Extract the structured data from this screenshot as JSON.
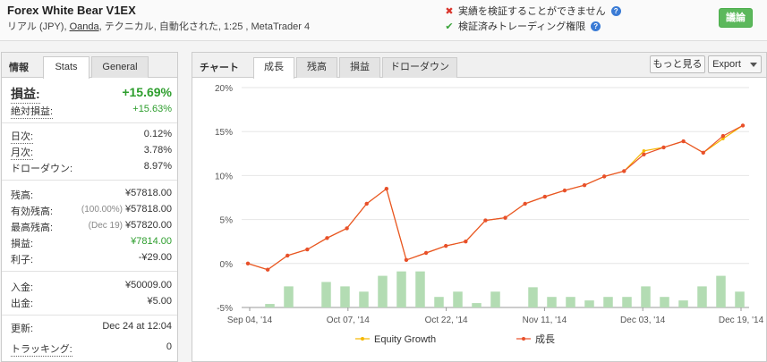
{
  "header": {
    "title": "Forex White Bear V1EX",
    "subtitle_pre": "リアル (JPY), ",
    "subtitle_link": "Oanda",
    "subtitle_post": ", テクニカル, 自動化された, 1:25 , MetaTrader 4",
    "verify_1": "実績を検証することができません",
    "verify_2": "検証済みトレーディング権限",
    "discuss_label": "議論"
  },
  "left": {
    "heading": "情報",
    "tabs": [
      "Stats",
      "General"
    ],
    "gain_label": "損益:",
    "gain_value": "+15.69%",
    "abs_gain_label": "絶対損益:",
    "abs_gain_value": "+15.63%",
    "daily_label": "日次:",
    "daily_value": "0.12%",
    "monthly_label": "月次:",
    "monthly_value": "3.78%",
    "drawdown_label": "ドローダウン:",
    "drawdown_value": "8.97%",
    "balance_label": "残高:",
    "balance_value": "¥57818.00",
    "equity_label": "有効残高:",
    "equity_note": "(100.00%)",
    "equity_value": "¥57818.00",
    "highest_label": "最高残高:",
    "highest_note": "(Dec 19)",
    "highest_value": "¥57820.00",
    "profit_label": "損益:",
    "profit_value": "¥7814.00",
    "interest_label": "利子:",
    "interest_value": "-¥29.00",
    "deposits_label": "入金:",
    "deposits_value": "¥50009.00",
    "withdrawals_label": "出金:",
    "withdrawals_value": "¥5.00",
    "updated_label": "更新:",
    "updated_value": "Dec 24 at 12:04",
    "tracking_label": "トラッキング:",
    "tracking_value": "0"
  },
  "chart_panel": {
    "heading": "チャート",
    "tabs": [
      "成長",
      "残高",
      "損益",
      "ドローダウン"
    ],
    "more_label": "もっと見る",
    "export_label": "Export"
  },
  "colors": {
    "growth": "#e8502a",
    "equity": "#f5b800",
    "bars": "#b3dcb3",
    "green_text": "#2e9e2e",
    "discuss_button": "#5cb85c"
  },
  "chart_data": {
    "type": "line",
    "yticks": [
      "20%",
      "15%",
      "10%",
      "5%",
      "0%",
      "-5%"
    ],
    "ylim": [
      -5,
      20
    ],
    "xticks": [
      "Sep 04, '14",
      "Oct 07, '14",
      "Oct 22, '14",
      "Nov 11, '14",
      "Dec 03, '14",
      "Dec 19, '14"
    ],
    "xlabel": "",
    "ylabel": "",
    "legend": [
      "Equity Growth",
      "成長"
    ],
    "series": [
      {
        "name": "成長",
        "values": [
          0,
          -0.7,
          0.9,
          1.6,
          2.9,
          4.0,
          6.8,
          8.5,
          0.4,
          1.2,
          2.0,
          2.5,
          4.9,
          5.2,
          6.8,
          7.6,
          8.3,
          8.9,
          9.9,
          10.5,
          12.4,
          13.2,
          13.9,
          12.6,
          14.5,
          15.69
        ]
      },
      {
        "name": "Equity Growth",
        "values": [
          0,
          -0.7,
          0.9,
          1.6,
          2.9,
          4.0,
          6.8,
          8.5,
          0.4,
          1.2,
          2.0,
          2.5,
          4.9,
          5.2,
          6.8,
          7.6,
          8.3,
          8.9,
          9.9,
          10.5,
          12.8,
          13.2,
          13.9,
          12.6,
          14.2,
          15.69
        ]
      }
    ],
    "bars_values": [
      0,
      0.4,
      2.4,
      0,
      2.9,
      2.4,
      1.8,
      3.6,
      4.1,
      4.1,
      1.2,
      1.8,
      0.5,
      1.8,
      0,
      2.3,
      1.2,
      1.2,
      0.8,
      1.2,
      1.2,
      2.4,
      1.2,
      0.8,
      2.4,
      3.6,
      1.8
    ]
  }
}
